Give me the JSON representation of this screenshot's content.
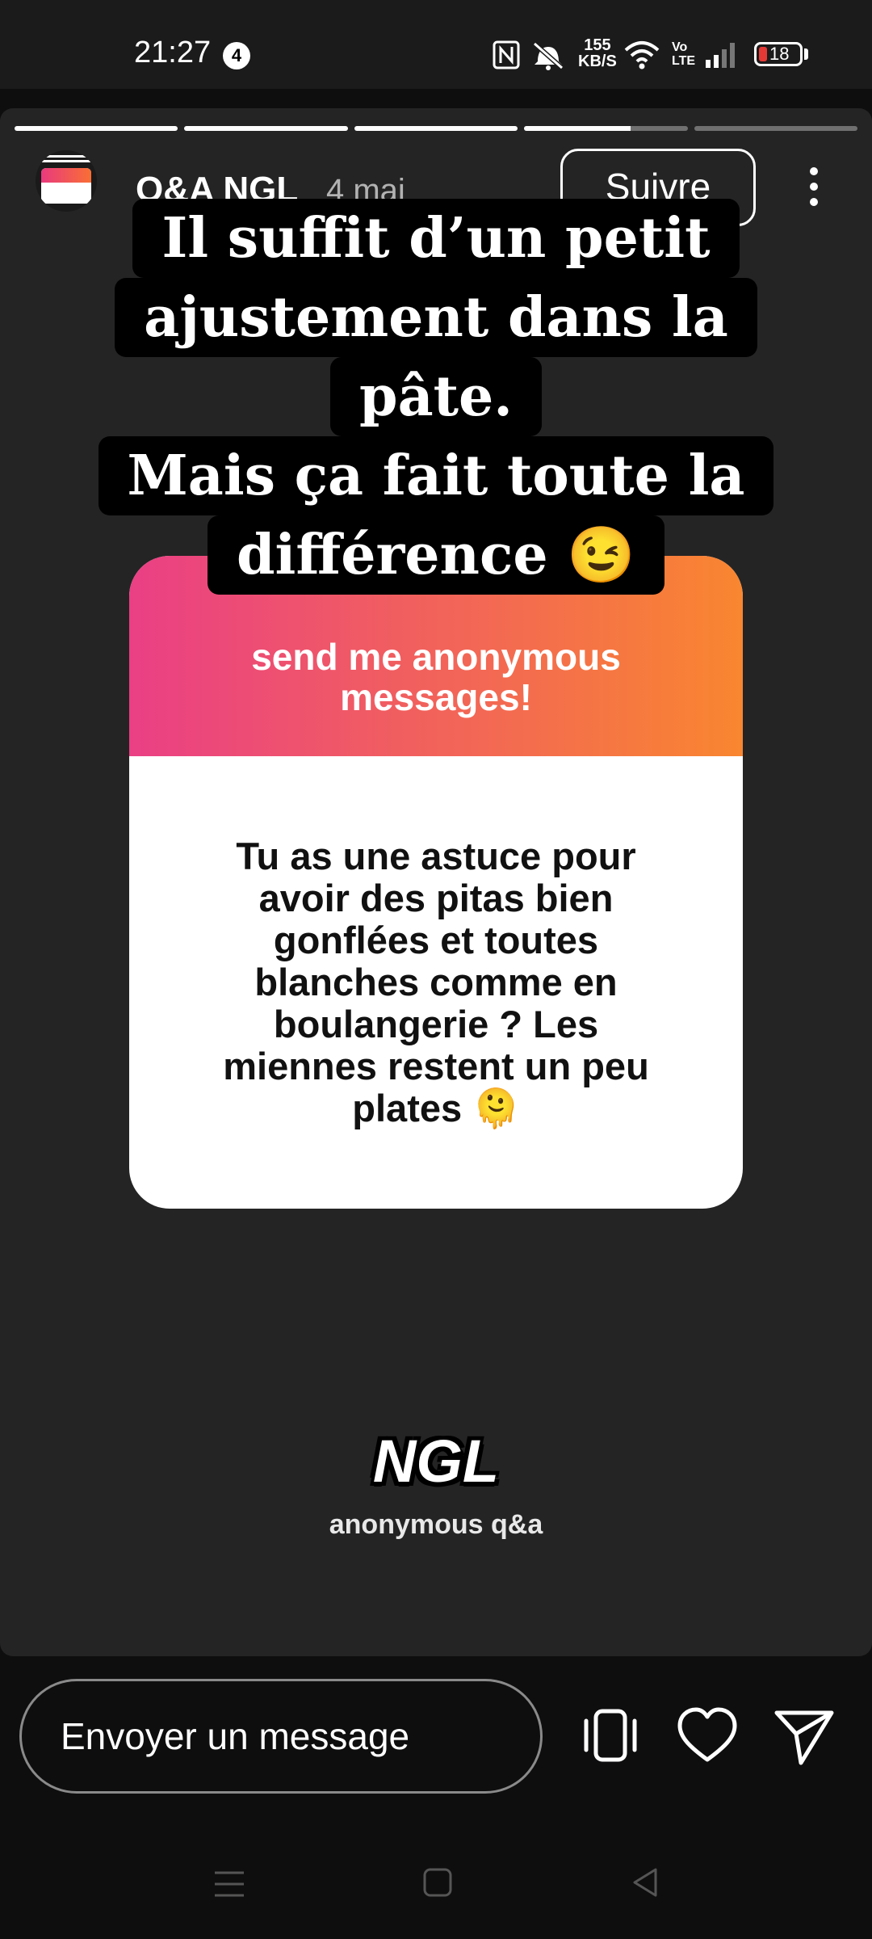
{
  "status_bar": {
    "time": "21:27",
    "notification_count": "4",
    "net_speed_value": "155",
    "net_speed_unit": "KB/S",
    "volte_top": "Vo",
    "volte_bottom": "LTE",
    "battery_level": "18",
    "battery_color": "#e53935"
  },
  "story": {
    "progress_segments": [
      1,
      1,
      1,
      0.65,
      0
    ],
    "username": "Q&A NGL",
    "date": "4 mai",
    "follow_label": "Suivre",
    "caption_lines": [
      "Il suffit d’un petit",
      "ajustement dans la",
      "pâte.",
      "Mais ça fait toute la",
      "différence 😉"
    ],
    "ngl_card": {
      "prompt_line1": "send me anonymous",
      "prompt_line2": "messages!",
      "question_lines": [
        "Tu as une astuce pour",
        "avoir des pitas bien",
        "gonflées et toutes",
        "blanches comme en",
        "boulangerie ? Les",
        "miennes restent un peu",
        "plates 🫠"
      ],
      "gradient_colors": [
        "#ea3f85",
        "#f98630"
      ]
    },
    "ngl_logo": "NGL",
    "ngl_subtitle": "anonymous q&a"
  },
  "reply_bar": {
    "placeholder": "Envoyer un message"
  },
  "icons": {
    "share_to": "phone-vibrate-icon",
    "like": "heart-icon",
    "send": "send-icon",
    "nav_menu": "menu-icon",
    "nav_home": "home-icon",
    "nav_back": "back-icon"
  }
}
